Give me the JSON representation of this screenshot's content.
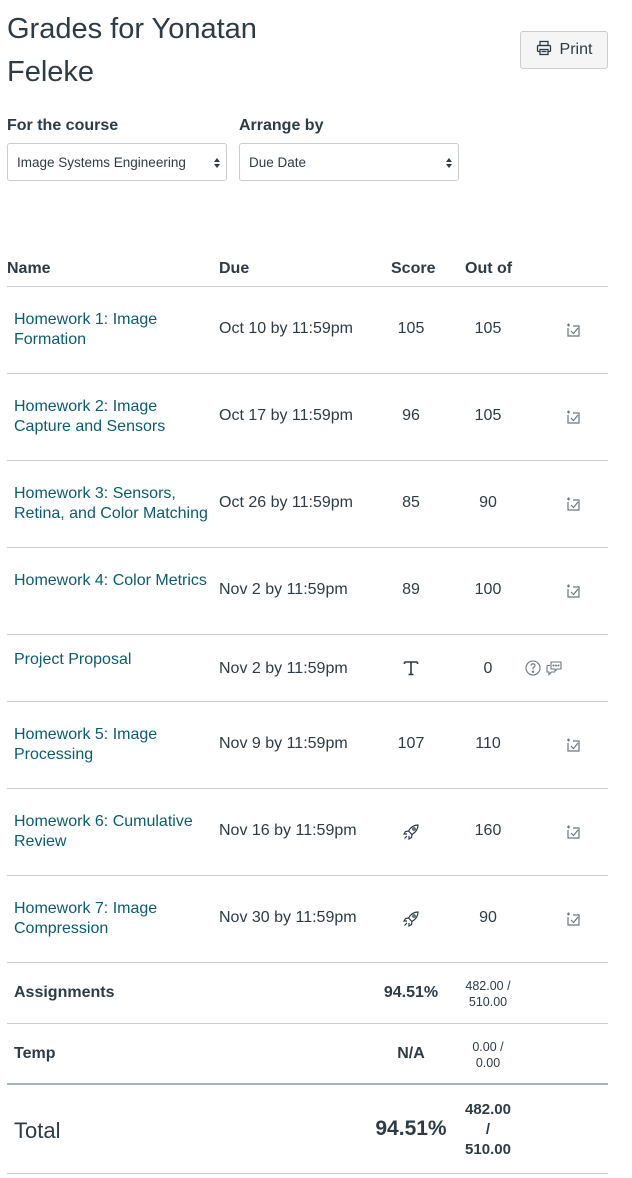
{
  "page": {
    "title": "Grades for Yonatan Feleke"
  },
  "toolbar": {
    "print_label": "Print"
  },
  "filters": {
    "course_label": "For the course",
    "course_value": "Image Systems Engineering",
    "arrange_label": "Arrange by",
    "arrange_value": "Due Date"
  },
  "table": {
    "headers": {
      "name": "Name",
      "due": "Due",
      "score": "Score",
      "out_of": "Out of"
    },
    "rows": [
      {
        "name": "Homework 1: Image Formation",
        "due": "Oct 10 by 11:59pm",
        "score": "105",
        "out_of": "105",
        "score_icon": null,
        "action_icon": "rubric-icon"
      },
      {
        "name": "Homework 2: Image Capture and Sensors",
        "due": "Oct 17 by 11:59pm",
        "score": "96",
        "out_of": "105",
        "score_icon": null,
        "action_icon": "rubric-icon"
      },
      {
        "name": "Homework 3: Sensors, Retina, and Color Matching",
        "due": "Oct 26 by 11:59pm",
        "score": "85",
        "out_of": "90",
        "score_icon": null,
        "action_icon": "rubric-icon"
      },
      {
        "name": "Homework 4: Color Metrics",
        "due": "Nov 2 by 11:59pm",
        "score": "89",
        "out_of": "100",
        "score_icon": null,
        "action_icon": "rubric-icon"
      },
      {
        "name": "Project Proposal",
        "due": "Nov 2 by 11:59pm",
        "score": "",
        "out_of": "0",
        "score_icon": "text-submission-icon",
        "action_icon": "what-if-comments-icons"
      },
      {
        "name": "Homework 5: Image Processing",
        "due": "Nov 9 by 11:59pm",
        "score": "107",
        "out_of": "110",
        "score_icon": null,
        "action_icon": "rubric-icon"
      },
      {
        "name": "Homework 6: Cumulative Review",
        "due": "Nov 16 by 11:59pm",
        "score": "",
        "out_of": "160",
        "score_icon": "submitted-rocket-icon",
        "action_icon": "rubric-icon"
      },
      {
        "name": "Homework 7: Image Compression",
        "due": "Nov 30 by 11:59pm",
        "score": "",
        "out_of": "90",
        "score_icon": "submitted-rocket-icon",
        "action_icon": "rubric-icon"
      }
    ],
    "groups": [
      {
        "label": "Assignments",
        "percent": "94.51%",
        "fraction_top": "482.00 /",
        "fraction_bottom": "510.00"
      },
      {
        "label": "Temp",
        "percent": "N/A",
        "fraction_top": "0.00 /",
        "fraction_bottom": "0.00"
      }
    ],
    "total": {
      "label": "Total",
      "percent": "94.51%",
      "fraction_top": "482.00",
      "fraction_slash": "/",
      "fraction_bottom": "510.00"
    }
  }
}
